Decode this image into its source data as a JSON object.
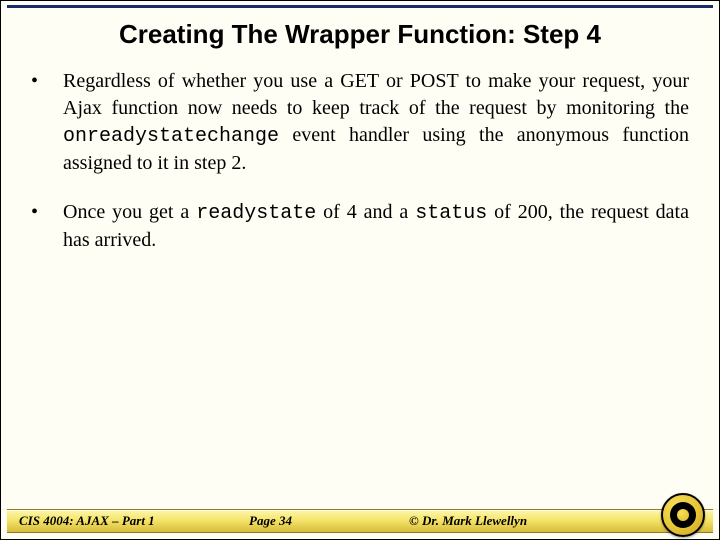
{
  "title": "Creating The Wrapper Function: Step 4",
  "bullets": [
    {
      "pre1": "Regardless of whether you use a GET or POST to make your request, your Ajax function now needs to keep track of the request by monitoring the ",
      "code1": "onreadystatechange",
      "post1": " event handler using the anonymous function assigned to it in step 2."
    },
    {
      "pre1": "Once you get a ",
      "code1": "readystate",
      "mid1": " of 4 and a ",
      "code2": "status",
      "post1": " of 200, the request data has arrived."
    }
  ],
  "footer": {
    "left": "CIS 4004: AJAX – Part 1",
    "page_label": "Page",
    "page_num": "34",
    "right": "© Dr. Mark Llewellyn"
  }
}
